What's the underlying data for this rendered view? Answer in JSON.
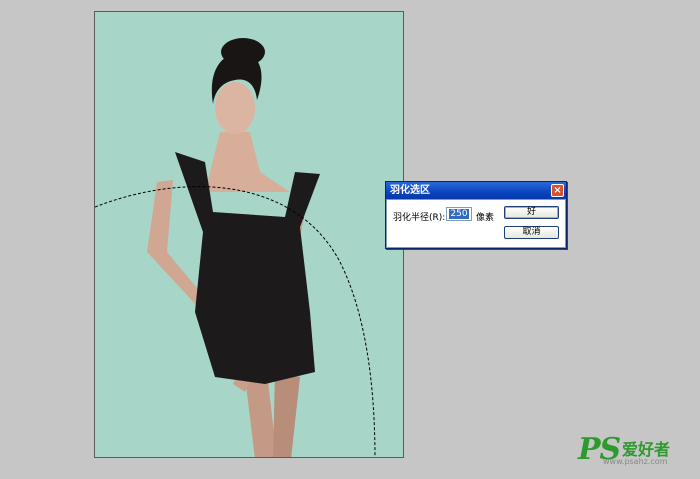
{
  "dialog": {
    "title": "羽化选区",
    "close_icon": "×",
    "radius_label": "羽化半径(R):",
    "radius_value": "250",
    "unit": "像素",
    "ok_label": "好",
    "cancel_label": "取消"
  },
  "watermark": {
    "brand": "PS",
    "brand_cn": "爱好者",
    "url": "www.psahz.com"
  },
  "colors": {
    "canvas_bg": "#a7d6c9",
    "workspace_bg": "#c6c6c6",
    "brand": "#2e9a2e"
  }
}
